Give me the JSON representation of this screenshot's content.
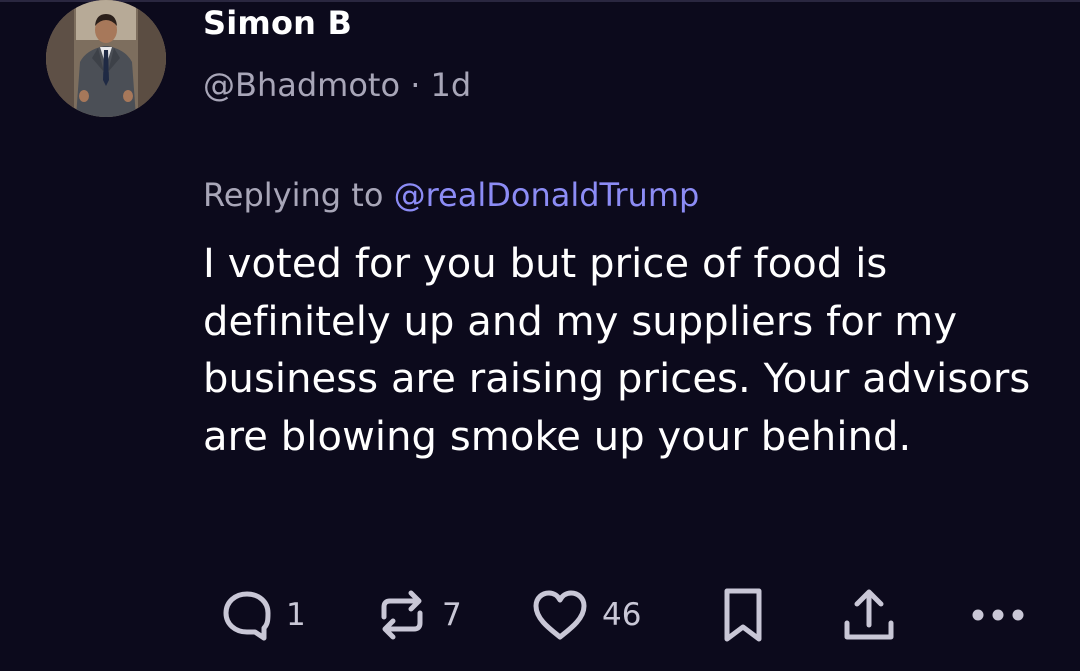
{
  "post": {
    "author": {
      "display_name": "Simon B",
      "handle": "@Bhadmoto",
      "separator": " · ",
      "time": "1d"
    },
    "reply": {
      "prefix": "Replying to ",
      "mention": "@realDonaldTrump"
    },
    "text": "I voted for you but price of food is definitely up and my suppliers for my business are raising prices. Your advisors are blowing smoke up your behind.",
    "actions": {
      "replies": "1",
      "reposts": "7",
      "likes": "46"
    },
    "icons": {
      "reply": "reply-icon",
      "repost": "repost-icon",
      "like": "heart-icon",
      "bookmark": "bookmark-icon",
      "share": "share-icon",
      "more": "more-icon"
    },
    "colors": {
      "background": "#0c0a1c",
      "mention": "#8c8cf5",
      "secondary_text": "#a8a6b8"
    }
  }
}
